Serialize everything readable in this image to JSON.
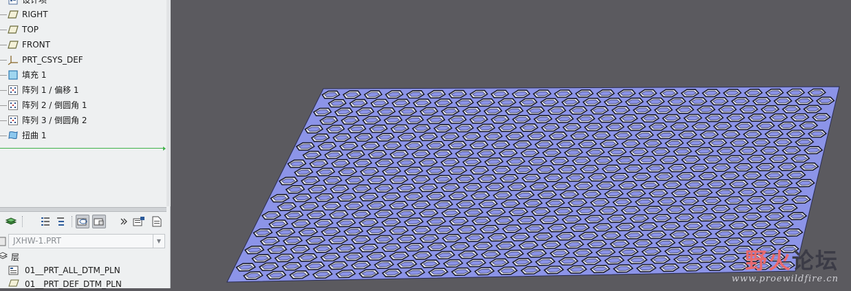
{
  "model_tree": {
    "items": [
      {
        "label": "设计项",
        "icon": "design-items-icon"
      },
      {
        "label": "RIGHT",
        "icon": "datum-plane-icon"
      },
      {
        "label": "TOP",
        "icon": "datum-plane-icon"
      },
      {
        "label": "FRONT",
        "icon": "datum-plane-icon"
      },
      {
        "label": "PRT_CSYS_DEF",
        "icon": "coordinate-system-icon"
      },
      {
        "label": "填充 1",
        "icon": "fill-feature-icon"
      },
      {
        "label": "阵列 1 / 偏移 1",
        "icon": "pattern-icon"
      },
      {
        "label": "阵列 2 / 倒圆角 1",
        "icon": "pattern-icon"
      },
      {
        "label": "阵列 3 / 倒圆角 2",
        "icon": "pattern-icon"
      },
      {
        "label": "扭曲 1",
        "icon": "warp-icon"
      }
    ]
  },
  "layer_panel": {
    "model": "JXHW-1.PRT",
    "header": "层",
    "layers": [
      {
        "label": "01__PRT_ALL_DTM_PLN"
      },
      {
        "label": "01__PRT_DEF_DTM_PLN"
      }
    ]
  },
  "watermark": {
    "text_a": "野火",
    "text_b": "论坛",
    "url": "www.proewildfire.cn"
  },
  "colors": {
    "viewport_bg": "#5b5a5f",
    "part_fill": "#8c94e8",
    "panel_bg": "#eef0f1"
  }
}
